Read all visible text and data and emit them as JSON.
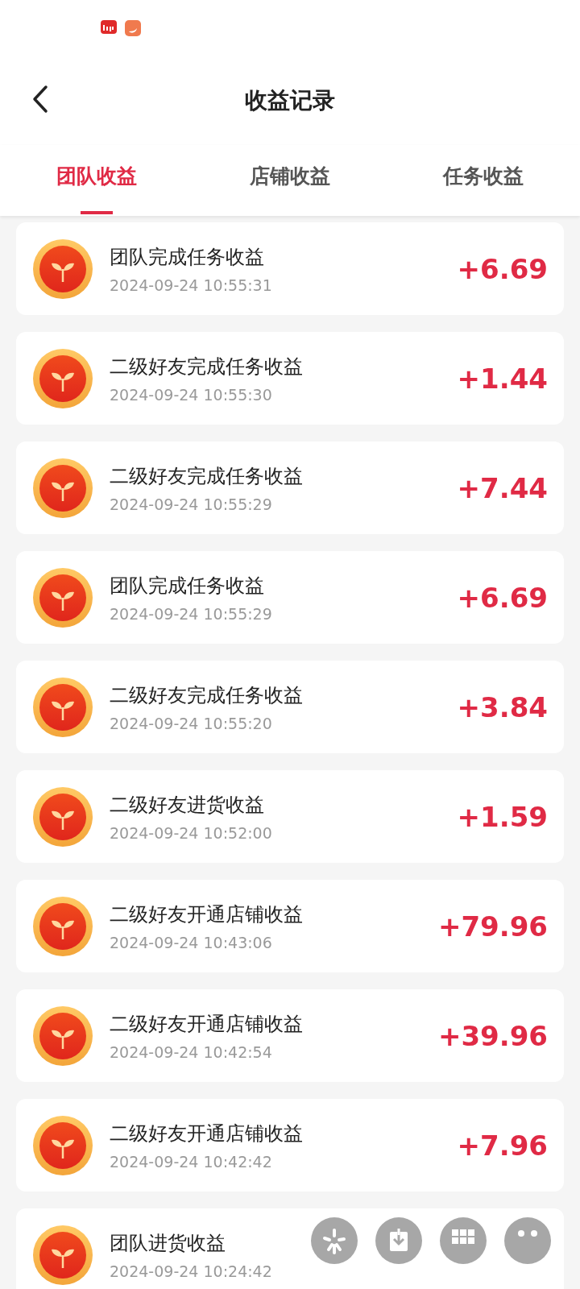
{
  "header": {
    "title": "收益记录"
  },
  "tabs": [
    {
      "label": "团队收益",
      "selected": true
    },
    {
      "label": "店铺收益",
      "selected": false
    },
    {
      "label": "任务收益",
      "selected": false
    }
  ],
  "records": [
    {
      "title": "团队完成任务收益",
      "time": "2024-09-24 10:55:31",
      "amount": "+6.69"
    },
    {
      "title": "二级好友完成任务收益",
      "time": "2024-09-24 10:55:30",
      "amount": "+1.44"
    },
    {
      "title": "二级好友完成任务收益",
      "time": "2024-09-24 10:55:29",
      "amount": "+7.44"
    },
    {
      "title": "团队完成任务收益",
      "time": "2024-09-24 10:55:29",
      "amount": "+6.69"
    },
    {
      "title": "二级好友完成任务收益",
      "time": "2024-09-24 10:55:20",
      "amount": "+3.84"
    },
    {
      "title": "二级好友进货收益",
      "time": "2024-09-24 10:52:00",
      "amount": "+1.59"
    },
    {
      "title": "二级好友开通店铺收益",
      "time": "2024-09-24 10:43:06",
      "amount": "+79.96"
    },
    {
      "title": "二级好友开通店铺收益",
      "time": "2024-09-24 10:42:54",
      "amount": "+39.96"
    },
    {
      "title": "二级好友开通店铺收益",
      "time": "2024-09-24 10:42:42",
      "amount": "+7.96"
    },
    {
      "title": "团队进货收益",
      "time": "2024-09-24 10:24:42"
    }
  ]
}
